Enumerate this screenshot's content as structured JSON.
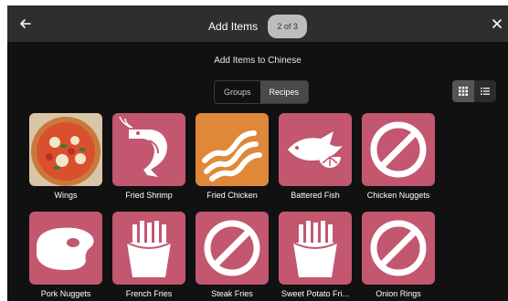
{
  "header": {
    "title": "Add Items",
    "step_badge": "2 of 3",
    "back_icon": "arrow-left-icon",
    "close_icon": "close-icon"
  },
  "subtitle": "Add Items to Chinese",
  "mode_tabs": [
    {
      "label": "Groups",
      "selected": false
    },
    {
      "label": "Recipes",
      "selected": true
    }
  ],
  "view_toggle": [
    {
      "icon": "grid-view-icon",
      "selected": true
    },
    {
      "icon": "list-view-icon",
      "selected": false
    }
  ],
  "colors": {
    "tile_pink": "#c2576f",
    "tile_orange": "#e0883a",
    "background": "#111111",
    "header": "#2e2e2e"
  },
  "items": [
    {
      "label": "Wings",
      "icon": "pizza-photo"
    },
    {
      "label": "Fried Shrimp",
      "icon": "shrimp-icon"
    },
    {
      "label": "Fried Chicken",
      "icon": "bacon-icon"
    },
    {
      "label": "Battered Fish",
      "icon": "fish-lemon-icon"
    },
    {
      "label": "Chicken Nuggets",
      "icon": "no-image-icon"
    },
    {
      "label": "Pork Nuggets",
      "icon": "steak-icon"
    },
    {
      "label": "French Fries",
      "icon": "fries-icon"
    },
    {
      "label": "Steak Fries",
      "icon": "no-image-icon"
    },
    {
      "label": "Sweet Potato Fri...",
      "icon": "fries-icon"
    },
    {
      "label": "Onion Rings",
      "icon": "no-image-icon"
    }
  ]
}
